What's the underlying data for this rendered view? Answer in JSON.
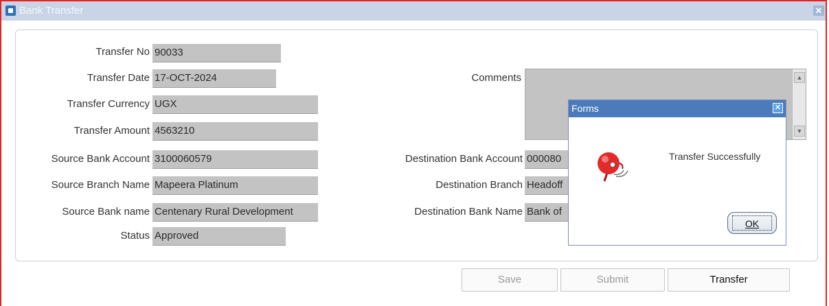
{
  "window": {
    "title": "Bank Transfer",
    "close_glyph": "✕"
  },
  "form": {
    "transfer_no": {
      "label": "Transfer No",
      "value": "90033"
    },
    "transfer_date": {
      "label": "Transfer Date",
      "value": "17-OCT-2024"
    },
    "transfer_currency": {
      "label": "Transfer Currency",
      "value": "UGX"
    },
    "transfer_amount": {
      "label": "Transfer Amount",
      "value": "4563210"
    },
    "source_bank_account": {
      "label": "Source Bank Account",
      "value": "3100060579"
    },
    "source_branch_name": {
      "label": "Source Branch Name",
      "value": "Mapeera Platinum"
    },
    "source_bank_name": {
      "label": "Source Bank name",
      "value": "Centenary Rural Development"
    },
    "status": {
      "label": "Status",
      "value": "Approved"
    },
    "comments": {
      "label": "Comments",
      "value": ""
    },
    "destination_bank_account": {
      "label": "Destination Bank Account",
      "value": "000080"
    },
    "destination_branch": {
      "label": "Destination Branch",
      "value": "Headoff"
    },
    "destination_bank_name": {
      "label": "Destination Bank Name",
      "value": "Bank of"
    }
  },
  "buttons": {
    "save": "Save",
    "submit": "Submit",
    "transfer": "Transfer"
  },
  "dialog": {
    "title": "Forms",
    "close_glyph": "✕",
    "message": "Transfer Successfully",
    "ok_label": "OK",
    "icon": "alarm-bell-icon"
  },
  "colors": {
    "title_bar": "#c9d5e6",
    "window_border": "#e52222",
    "dialog_title": "#4b7bbb",
    "field_bg": "#c3c3c3"
  }
}
